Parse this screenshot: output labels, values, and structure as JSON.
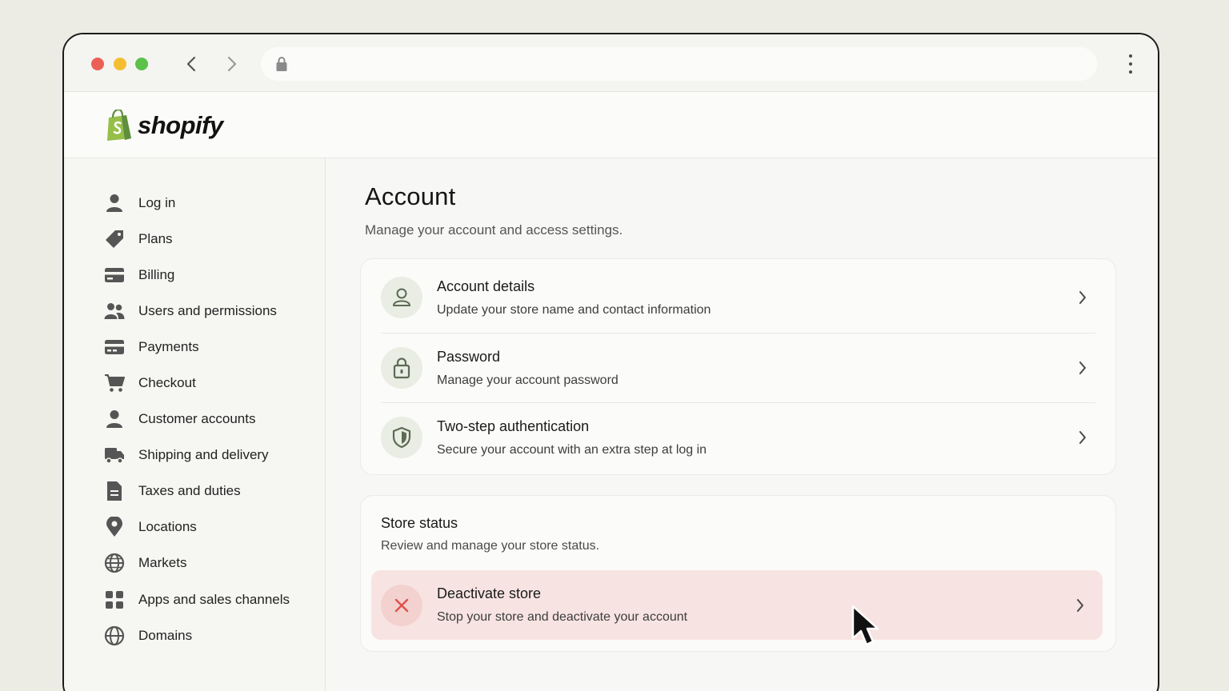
{
  "browser": {
    "url": "",
    "controls": [
      "close",
      "minimize",
      "maximize"
    ]
  },
  "brand": {
    "name": "shopify",
    "logo_icon": "shopify-bag-icon",
    "accent": "#95bf47"
  },
  "sidebar": {
    "items": [
      {
        "label": "Log in",
        "icon": "person-icon"
      },
      {
        "label": "Plans",
        "icon": "tag-icon"
      },
      {
        "label": "Billing",
        "icon": "credit-card-icon"
      },
      {
        "label": "Users and permissions",
        "icon": "users-icon"
      },
      {
        "label": "Payments",
        "icon": "card-icon"
      },
      {
        "label": "Checkout",
        "icon": "cart-icon"
      },
      {
        "label": "Customer accounts",
        "icon": "person-icon"
      },
      {
        "label": "Shipping and delivery",
        "icon": "truck-icon"
      },
      {
        "label": "Taxes and duties",
        "icon": "document-icon"
      },
      {
        "label": "Locations",
        "icon": "location-pin-icon"
      },
      {
        "label": "Markets",
        "icon": "globe-icon"
      },
      {
        "label": "Apps and sales channels",
        "icon": "apps-grid-icon"
      },
      {
        "label": "Domains",
        "icon": "globe-icon"
      }
    ]
  },
  "main": {
    "title": "Account",
    "subtitle": "Manage your account and access settings.",
    "account_rows": [
      {
        "title": "Account details",
        "desc": "Update your store name and contact information",
        "icon": "person-icon"
      },
      {
        "title": "Password",
        "desc": "Manage your account password",
        "icon": "lock-icon"
      },
      {
        "title": "Two-step authentication",
        "desc": "Secure your account with an extra step at log in",
        "icon": "shield-icon"
      }
    ],
    "store_status": {
      "title": "Store status",
      "desc": "Review and manage your store status.",
      "danger_row": {
        "title": "Deactivate store",
        "desc": "Stop your store and deactivate your account",
        "icon": "close-x-icon",
        "color": "#e0504a"
      }
    }
  }
}
